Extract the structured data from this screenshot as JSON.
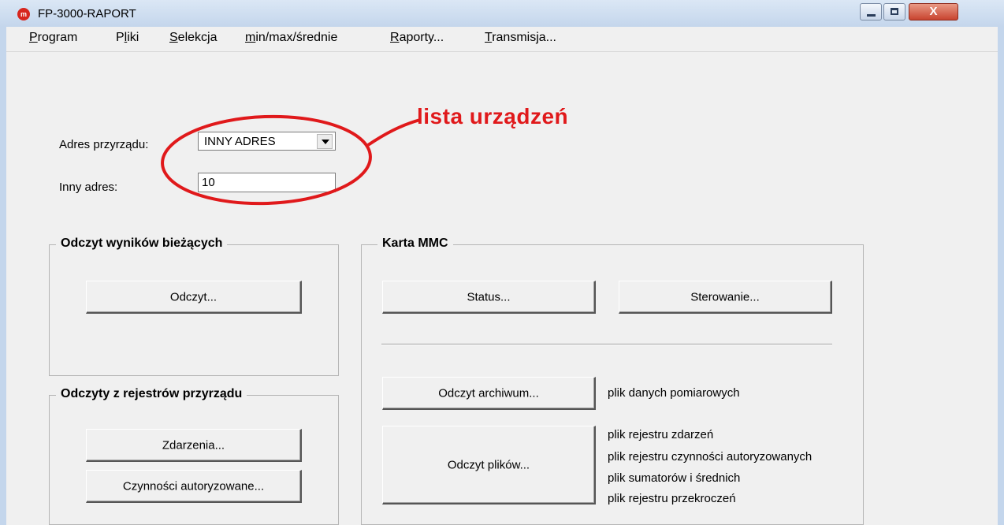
{
  "window": {
    "title": "FP-3000-RAPORT",
    "icon": "m-logo-icon",
    "close_symbol": "X"
  },
  "menu": [
    {
      "pre": "",
      "u": "P",
      "post": "rogram"
    },
    {
      "pre": "P",
      "u": "l",
      "post": "iki"
    },
    {
      "pre": "",
      "u": "S",
      "post": "elekcja"
    },
    {
      "pre": "",
      "u": "m",
      "post": "in/max/średnie"
    },
    {
      "pre": "",
      "u": "R",
      "post": "aporty..."
    },
    {
      "pre": "",
      "u": "T",
      "post": "ransmisja..."
    }
  ],
  "form": {
    "address_label": "Adres przyrządu:",
    "address_value": "INNY ADRES",
    "other_label": "Inny adres:",
    "other_value": "10"
  },
  "annotation": {
    "text": "lista urządzeń",
    "color": "#e0191b"
  },
  "group_current": {
    "title": "Odczyt wyników bieżących",
    "button": "Odczyt..."
  },
  "group_registers": {
    "title": "Odczyty z rejestrów przyrządu",
    "events_button": "Zdarzenia...",
    "auth_button": "Czynności autoryzowane..."
  },
  "group_mmc": {
    "title": "Karta MMC",
    "status_button": "Status...",
    "control_button": "Sterowanie...",
    "archive_button": "Odczyt archiwum...",
    "archive_desc": "plik danych pomiarowych",
    "files_button": "Odczyt plików...",
    "files_desc": [
      "plik rejestru zdarzeń",
      "plik rejestru czynności autoryzowanych",
      "plik sumatorów i średnich",
      "plik rejestru przekroczeń"
    ]
  }
}
